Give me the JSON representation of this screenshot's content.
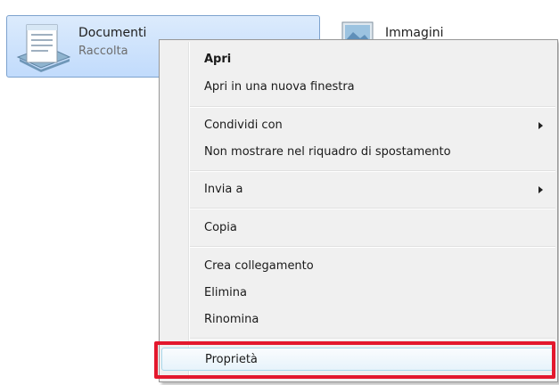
{
  "libraries": [
    {
      "title": "Documenti",
      "subtitle": "Raccolta",
      "icon": "documents-library-icon"
    },
    {
      "title": "Immagini",
      "icon": "pictures-library-icon"
    }
  ],
  "context_menu": {
    "items": [
      {
        "label": "Apri",
        "bold": true
      },
      {
        "label": "Apri in una nuova finestra"
      },
      {
        "label": "Condividi con",
        "submenu": true
      },
      {
        "label": "Non mostrare nel riquadro di spostamento"
      },
      {
        "label": "Invia a",
        "submenu": true
      },
      {
        "label": "Copia"
      },
      {
        "label": "Crea collegamento"
      },
      {
        "label": "Elimina"
      },
      {
        "label": "Rinomina"
      },
      {
        "label": "Proprietà",
        "highlighted": true
      }
    ]
  },
  "colors": {
    "selection_fill": "#c1dbfc",
    "selection_border": "#7da2ce",
    "menu_background": "#f0f0f0",
    "highlight_outline": "#e3182d"
  }
}
